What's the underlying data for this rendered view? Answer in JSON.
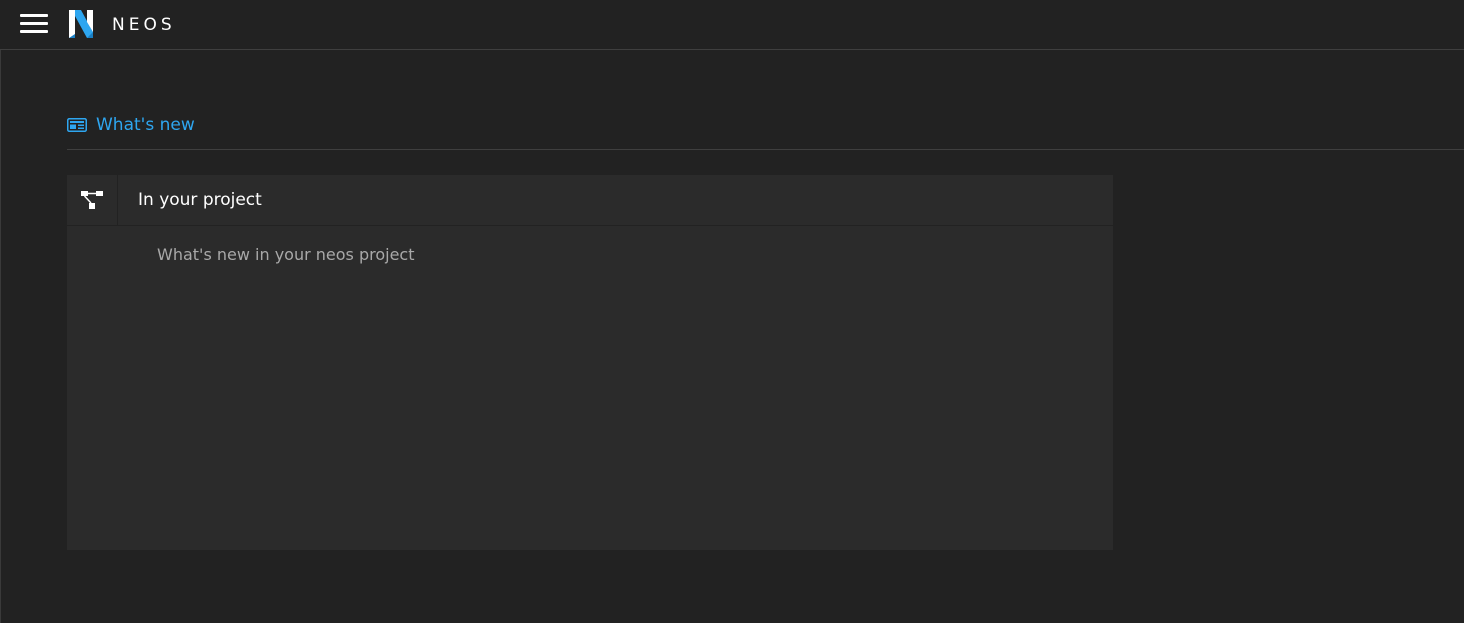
{
  "app": {
    "brand": "NEOS",
    "menu_icon": "hamburger-icon",
    "logo_icon": "neos-logo-icon",
    "accent_color": "#2ea6f0"
  },
  "section": {
    "icon": "newspaper-icon",
    "title": "What's new"
  },
  "panel": {
    "icon": "sitemap-icon",
    "title": "In your project",
    "body": "What's new in your neos project"
  }
}
